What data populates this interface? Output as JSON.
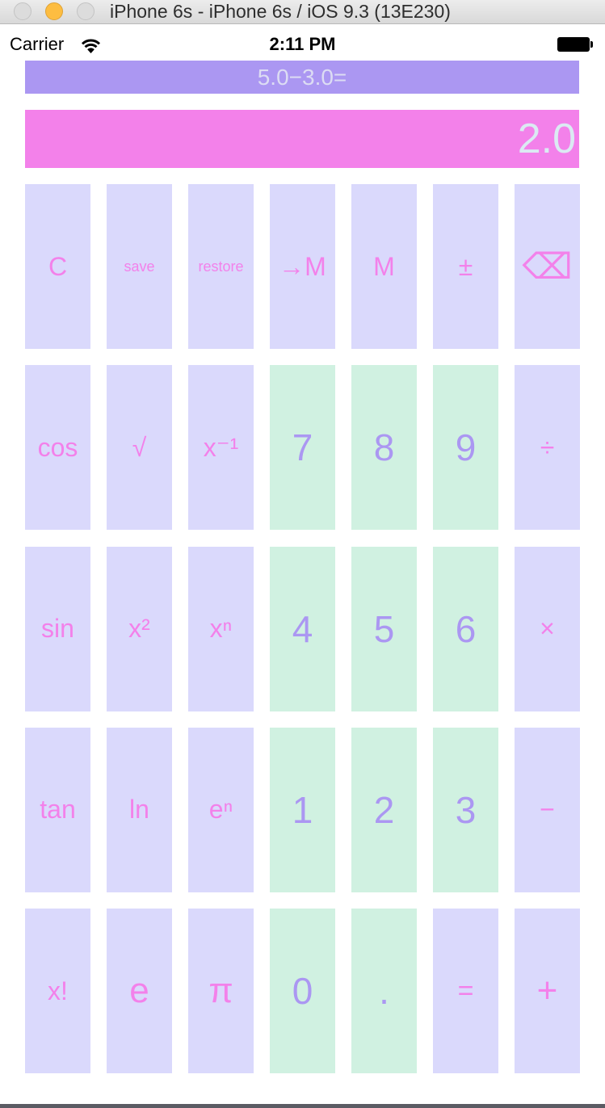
{
  "window": {
    "title": "iPhone 6s - iPhone 6s / iOS 9.3 (13E230)"
  },
  "status_bar": {
    "carrier": "Carrier",
    "time": "2:11 PM"
  },
  "calculator": {
    "history": "5.0−3.0=",
    "display": "2.0"
  },
  "keys": [
    {
      "label": "C",
      "style": "med"
    },
    {
      "label": "save",
      "style": "small"
    },
    {
      "label": "restore",
      "style": "small"
    },
    {
      "label": "→M",
      "style": "med"
    },
    {
      "label": "M",
      "style": "med"
    },
    {
      "label": "±",
      "style": "med"
    },
    {
      "label": "⌫",
      "style": "big"
    },
    {
      "label": "cos",
      "style": "med"
    },
    {
      "label": "√",
      "style": "med"
    },
    {
      "label": "x⁻¹",
      "style": "med"
    },
    {
      "label": "7",
      "style": "num"
    },
    {
      "label": "8",
      "style": "num"
    },
    {
      "label": "9",
      "style": "num"
    },
    {
      "label": "÷",
      "style": "med"
    },
    {
      "label": "sin",
      "style": "med"
    },
    {
      "label": "x²",
      "style": "med"
    },
    {
      "label": "xⁿ",
      "style": "med"
    },
    {
      "label": "4",
      "style": "num"
    },
    {
      "label": "5",
      "style": "num"
    },
    {
      "label": "6",
      "style": "num"
    },
    {
      "label": "×",
      "style": "med"
    },
    {
      "label": "tan",
      "style": "med"
    },
    {
      "label": "ln",
      "style": "med"
    },
    {
      "label": "eⁿ",
      "style": "med"
    },
    {
      "label": "1",
      "style": "num"
    },
    {
      "label": "2",
      "style": "num"
    },
    {
      "label": "3",
      "style": "num"
    },
    {
      "label": "−",
      "style": "med"
    },
    {
      "label": "x!",
      "style": "med"
    },
    {
      "label": "e",
      "style": "big"
    },
    {
      "label": "π",
      "style": "big"
    },
    {
      "label": "0",
      "style": "num"
    },
    {
      "label": ".",
      "style": "num"
    },
    {
      "label": "=",
      "style": "eq"
    },
    {
      "label": "+",
      "style": "big"
    }
  ],
  "colors": {
    "history_bg": "#ab97f2",
    "display_bg": "#f381ea",
    "function_key_bg": "#dad9fc",
    "digit_key_bg": "#d0f1e1",
    "function_key_text": "#f381ea",
    "digit_key_text": "#ab97f2"
  }
}
